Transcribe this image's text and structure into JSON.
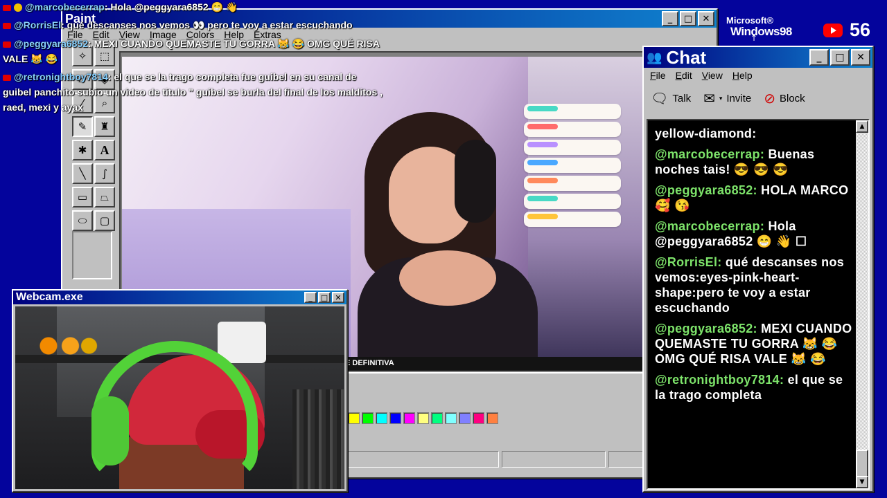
{
  "paint": {
    "title": "Paint",
    "menu": [
      "File",
      "Edit",
      "View",
      "Image",
      "Colors",
      "Help",
      "Extras"
    ],
    "caption": "E DEFINITIVA",
    "palette": [
      "#ffff00",
      "#00ff00",
      "#00ffff",
      "#0000ff",
      "#ff00ff",
      "#ffff80",
      "#00ff80",
      "#80ffff",
      "#8080ff",
      "#ff0080",
      "#ff8040"
    ]
  },
  "webcam": {
    "title": "Webcam.exe"
  },
  "chat": {
    "title": "Chat",
    "menu": [
      "File",
      "Edit",
      "View",
      "Help"
    ],
    "toolbar": {
      "talk": "Talk",
      "invite": "Invite",
      "block": "Block"
    },
    "partial": "yellow-diamond:",
    "messages": [
      {
        "user": "@marcobecerrap:",
        "text": "Buenas noches tais! 😎 😎 😎"
      },
      {
        "user": "@peggyara6852:",
        "text": "HOLA MARCO 🥰 😘"
      },
      {
        "user": "@marcobecerrap:",
        "text": "Hola @peggyara6852 😁 👋 ☐"
      },
      {
        "user": "@RorrisEl:",
        "text": "qué descanses nos vemos:eyes-pink-heart-shape:pero te voy a estar escuchando"
      },
      {
        "user": "@peggyara6852:",
        "text": "MEXI CUANDO QUEMASTE TU GORRA 😹 😂 OMG QUÉ RISA VALE 😹 😂"
      },
      {
        "user": "@retronightboy7814:",
        "text": "el que se la trago completa"
      }
    ]
  },
  "overlay": [
    {
      "user": "@marcobecerrap",
      "text": ": Hola @peggyara6852 😁 👋"
    },
    {
      "user": "@RorrisEl",
      "text": ": qué descanses nos vemos 👀 pero te voy a estar escuchando"
    },
    {
      "user": "@peggyara6852",
      "text": ": MEXI CUANDO QUEMASTE TU GORRA 😹 😂 OMG QUÉ RISA"
    },
    {
      "user": "",
      "text": "VALE 😹 😂"
    },
    {
      "user": "@retronightboy7814",
      "text": ": el que se la trago completa fue guibel en su canal de"
    },
    {
      "user": "",
      "text": "guibel panchito subio un video de titulo \" guibel se burla del final de los malditos ,"
    },
    {
      "user": "",
      "text": "raed, mexi y ayax"
    }
  ],
  "branding": {
    "microsoft": "Microsoft®",
    "windows": "Windows98"
  },
  "youtube": {
    "viewers": "56"
  }
}
